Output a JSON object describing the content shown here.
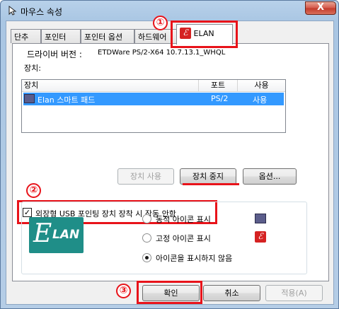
{
  "window": {
    "title": "마우스 속성",
    "close_label": "X"
  },
  "tabs": [
    {
      "label": "단추"
    },
    {
      "label": "포인터"
    },
    {
      "label": "포인터 옵션"
    },
    {
      "label": "하드웨어"
    },
    {
      "label": "ELAN"
    }
  ],
  "driver": {
    "label": "드라이버 버전 :",
    "value": "ETDWare PS/2-X64 10.7.13.1_WHQL"
  },
  "devices": {
    "label": "장치:",
    "columns": [
      "장치",
      "포트",
      "사용"
    ],
    "rows": [
      {
        "name": "Elan 스마트 패드",
        "port": "PS/2",
        "enabled": "사용"
      }
    ]
  },
  "device_buttons": {
    "enable": "장치 사용",
    "disable": "장치 중지",
    "options": "옵션..."
  },
  "external_usb": {
    "checked": true,
    "label": "외장형 USB 포인팅 장치 장착 시 작동 안함"
  },
  "icon_options": {
    "items": [
      {
        "label": "동적 아이콘 표시",
        "selected": false,
        "icon": "mouse-monitor-icon"
      },
      {
        "label": "고정 아이콘 표시",
        "selected": false,
        "icon": "elan-icon"
      },
      {
        "label": "아이콘을 표시하지 않음",
        "selected": true
      }
    ]
  },
  "logo": {
    "big": "E",
    "text": "LAN"
  },
  "footer": {
    "ok": "확인",
    "cancel": "취소",
    "apply": "적용(A)"
  },
  "annotations": {
    "marker1": "①",
    "marker2": "②",
    "marker3": "③",
    "color": "#e8131a"
  }
}
